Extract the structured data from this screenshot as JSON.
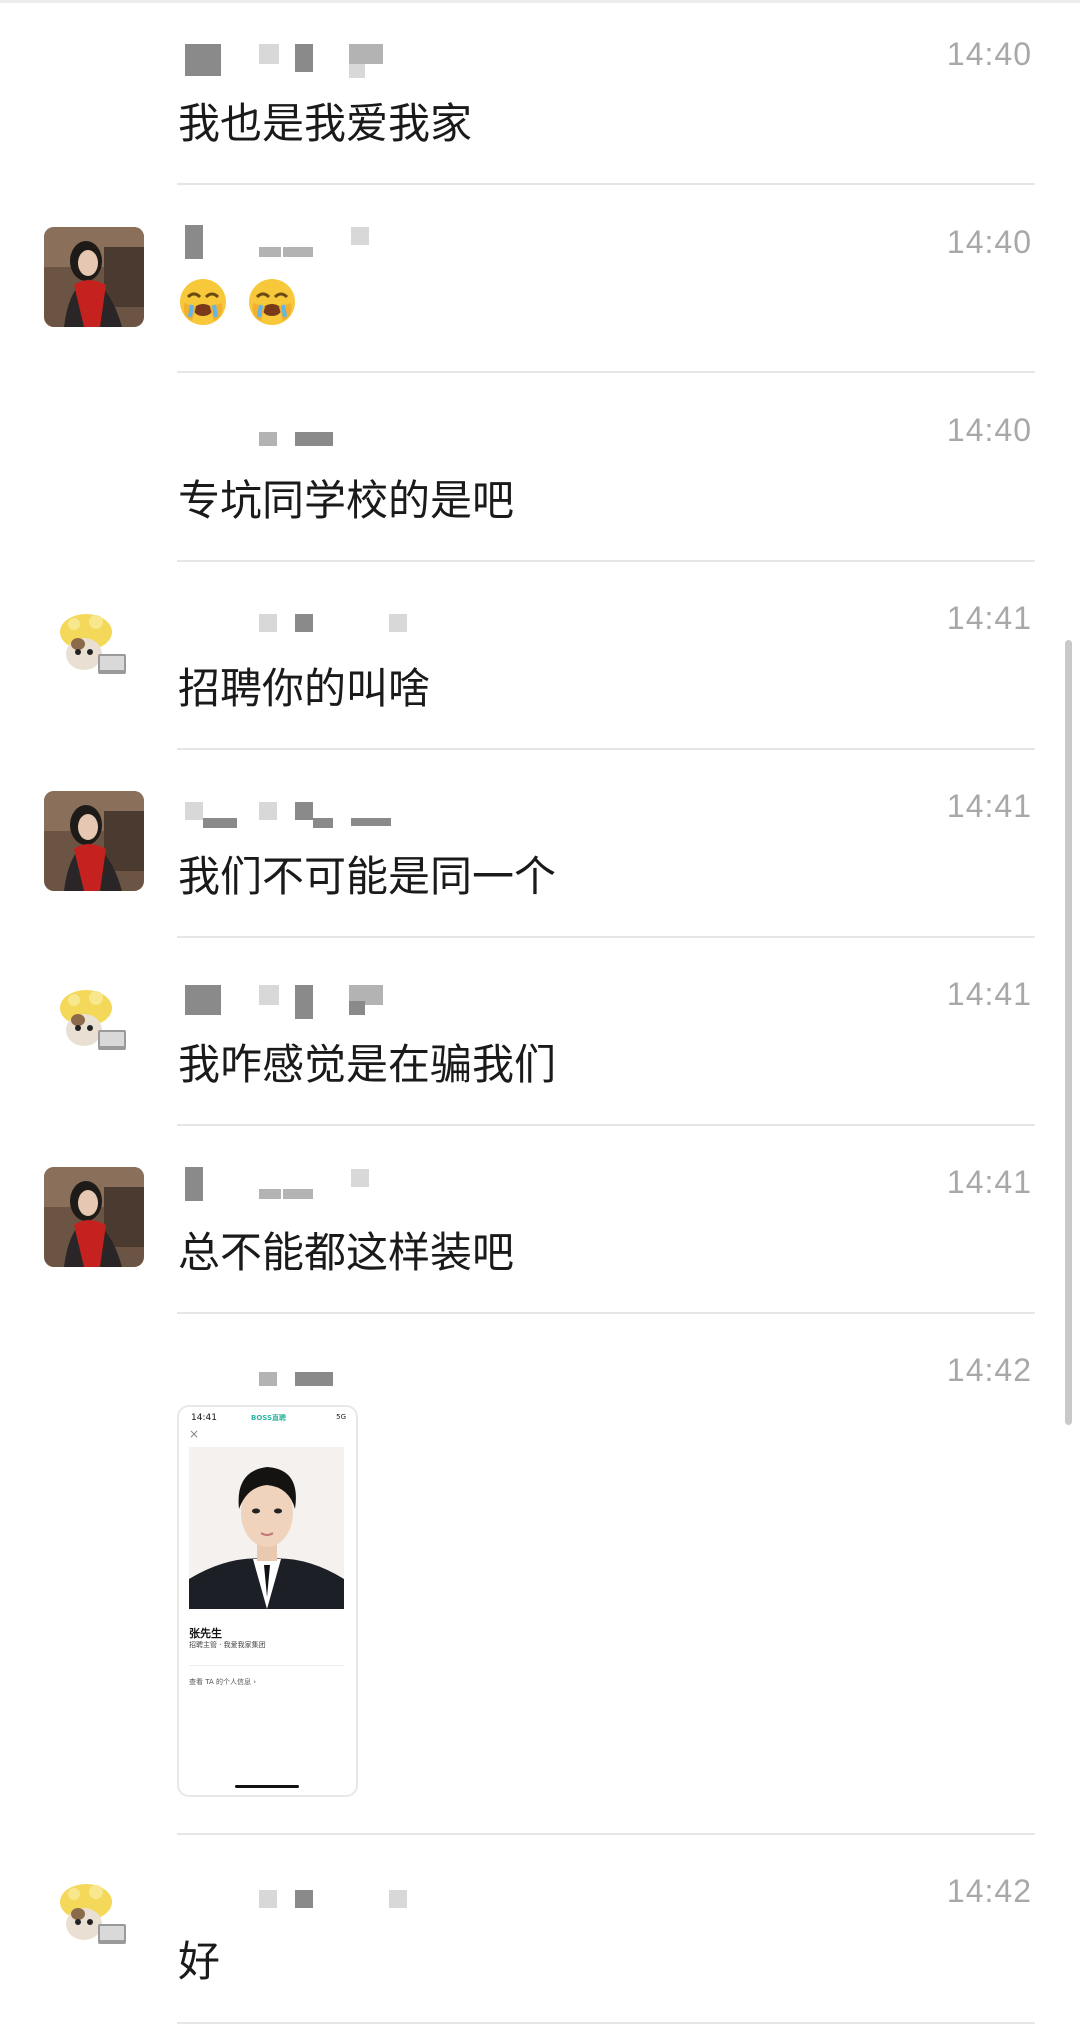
{
  "messages": [
    {
      "text": "我也是我爱我家",
      "time": "14:40",
      "avatar": "none"
    },
    {
      "text": "",
      "time": "14:40",
      "avatar": "girl-red-scarf",
      "emojis": [
        "face-palm-emoji",
        "face-palm-emoji"
      ]
    },
    {
      "text": "专坑同学校的是吧",
      "time": "14:40",
      "avatar": "none"
    },
    {
      "text": "招聘你的叫啥",
      "time": "14:41",
      "avatar": "cat-laptop"
    },
    {
      "text": "我们不可能是同一个",
      "time": "14:41",
      "avatar": "girl-red-scarf"
    },
    {
      "text": "我咋感觉是在骗我们",
      "time": "14:41",
      "avatar": "cat-laptop"
    },
    {
      "text": "总不能都这样装吧",
      "time": "14:41",
      "avatar": "girl-red-scarf"
    },
    {
      "text": "",
      "time": "14:42",
      "avatar": "none",
      "image": true
    },
    {
      "text": "好",
      "time": "14:42",
      "avatar": "cat-laptop"
    }
  ],
  "shared_image": {
    "status_time": "14:41",
    "app_name": "BOSS直聘",
    "signal": "5G",
    "close_glyph": "×",
    "contact_name": "张先生",
    "contact_role": "招聘主管 · 我爱我家集团",
    "view_info": "查看 TA 的个人信息 ›"
  },
  "colors": {
    "time": "#a8a8a8",
    "text": "#1a1a1a",
    "divider": "#e6e6e6",
    "accent": "#2fb5a3"
  }
}
